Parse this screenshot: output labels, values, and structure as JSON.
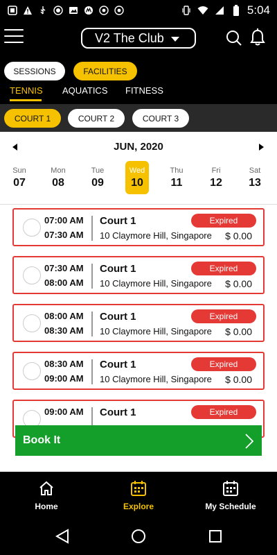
{
  "status_bar": {
    "time": "5:04"
  },
  "header": {
    "club": "V2 The Club"
  },
  "segments": {
    "sessions": "SESSIONS",
    "facilities": "FACILITIES"
  },
  "sport_tabs": {
    "tennis": "TENNIS",
    "aquatics": "AQUATICS",
    "fitness": "FITNESS"
  },
  "courts": [
    "COURT 1",
    "COURT 2",
    "COURT 3"
  ],
  "calendar": {
    "month": "JUN, 2020",
    "days": [
      {
        "name": "Sun",
        "num": "07"
      },
      {
        "name": "Mon",
        "num": "08"
      },
      {
        "name": "Tue",
        "num": "09"
      },
      {
        "name": "Wed",
        "num": "10"
      },
      {
        "name": "Thu",
        "num": "11"
      },
      {
        "name": "Fri",
        "num": "12"
      },
      {
        "name": "Sat",
        "num": "13"
      }
    ]
  },
  "slots": [
    {
      "start": "07:00 AM",
      "end": "07:30 AM",
      "court": "Court 1",
      "address": "10 Claymore Hill, Singapore",
      "status": "Expired",
      "price": "$ 0.00"
    },
    {
      "start": "07:30 AM",
      "end": "08:00 AM",
      "court": "Court 1",
      "address": "10 Claymore Hill, Singapore",
      "status": "Expired",
      "price": "$ 0.00"
    },
    {
      "start": "08:00 AM",
      "end": "08:30 AM",
      "court": "Court 1",
      "address": "10 Claymore Hill, Singapore",
      "status": "Expired",
      "price": "$ 0.00"
    },
    {
      "start": "08:30 AM",
      "end": "09:00 AM",
      "court": "Court 1",
      "address": "10 Claymore Hill, Singapore",
      "status": "Expired",
      "price": "$ 0.00"
    },
    {
      "start": "09:00 AM",
      "end": "",
      "court": "Court 1",
      "address": "",
      "status": "Expired",
      "price": ""
    }
  ],
  "book_button": "Book It",
  "bottom_nav": {
    "home": "Home",
    "explore": "Explore",
    "schedule": "My Schedule"
  },
  "colors": {
    "accent": "#f6c200",
    "expired": "#e53935",
    "book": "#149e2a"
  }
}
